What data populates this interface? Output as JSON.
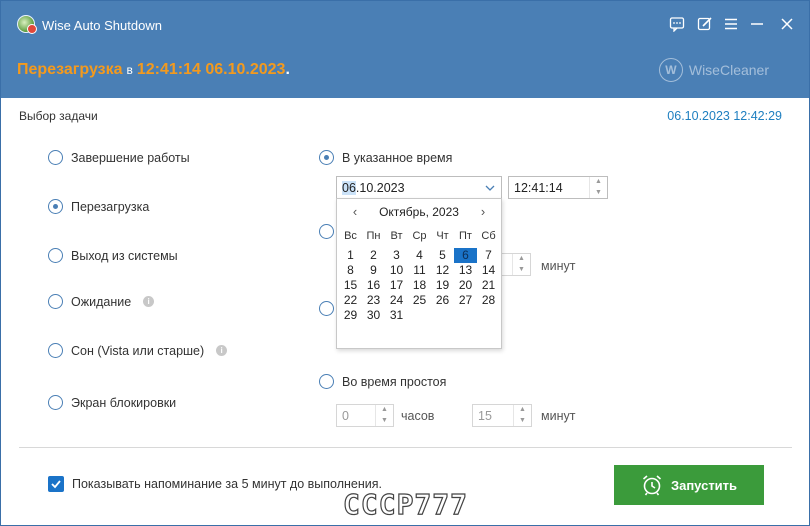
{
  "window": {
    "title": "Wise Auto Shutdown",
    "title_controls": [
      "feedback-icon",
      "edit-icon",
      "menu-icon",
      "minimize-icon",
      "close-icon"
    ]
  },
  "header": {
    "action": "Перезагрузка",
    "connector": "в",
    "scheduled": "12:41:14 06.10.2023",
    "suffix": ".",
    "brand": "WiseCleaner",
    "brand_logo_letter": "W",
    "accent_color": "#f39a1e"
  },
  "task_section": {
    "label": "Выбор задачи",
    "current_datetime": "06.10.2023 12:42:29"
  },
  "tasks": [
    {
      "label": "Завершение работы",
      "checked": false
    },
    {
      "label": "Перезагрузка",
      "checked": true
    },
    {
      "label": "Выход из системы",
      "checked": false
    },
    {
      "label": "Ожидание",
      "checked": false,
      "info": true
    },
    {
      "label": "Сон (Vista или старше)",
      "checked": false,
      "info": true
    },
    {
      "label": "Экран блокировки",
      "checked": false
    }
  ],
  "timing": {
    "specified_time": {
      "label": "В указанное время",
      "checked": true,
      "date_selected_part": "06",
      "date_rest": ".10.2023",
      "time_value": "12:41:14"
    },
    "interval_unit": "минут",
    "idle": {
      "label": "Во время простоя",
      "checked": false,
      "hours_value": "0",
      "hours_unit": "часов",
      "minutes_value": "15",
      "minutes_unit": "минут"
    }
  },
  "calendar": {
    "title": "Октябрь, 2023",
    "weekdays": [
      "Вс",
      "Пн",
      "Вт",
      "Ср",
      "Чт",
      "Пт",
      "Сб"
    ],
    "weeks": [
      [
        "1",
        "2",
        "3",
        "4",
        "5",
        "6",
        "7"
      ],
      [
        "8",
        "9",
        "10",
        "11",
        "12",
        "13",
        "14"
      ],
      [
        "15",
        "16",
        "17",
        "18",
        "19",
        "20",
        "21"
      ],
      [
        "22",
        "23",
        "24",
        "25",
        "26",
        "27",
        "28"
      ],
      [
        "29",
        "30",
        "31",
        "",
        "",
        "",
        ""
      ]
    ],
    "selected_day": "6"
  },
  "footer": {
    "reminder_checked": true,
    "reminder": "Показывать напоминание за 5 минут до выполнения.",
    "start_label": "Запустить",
    "start_color": "#3b9b3b",
    "watermark": "CCCP777"
  }
}
